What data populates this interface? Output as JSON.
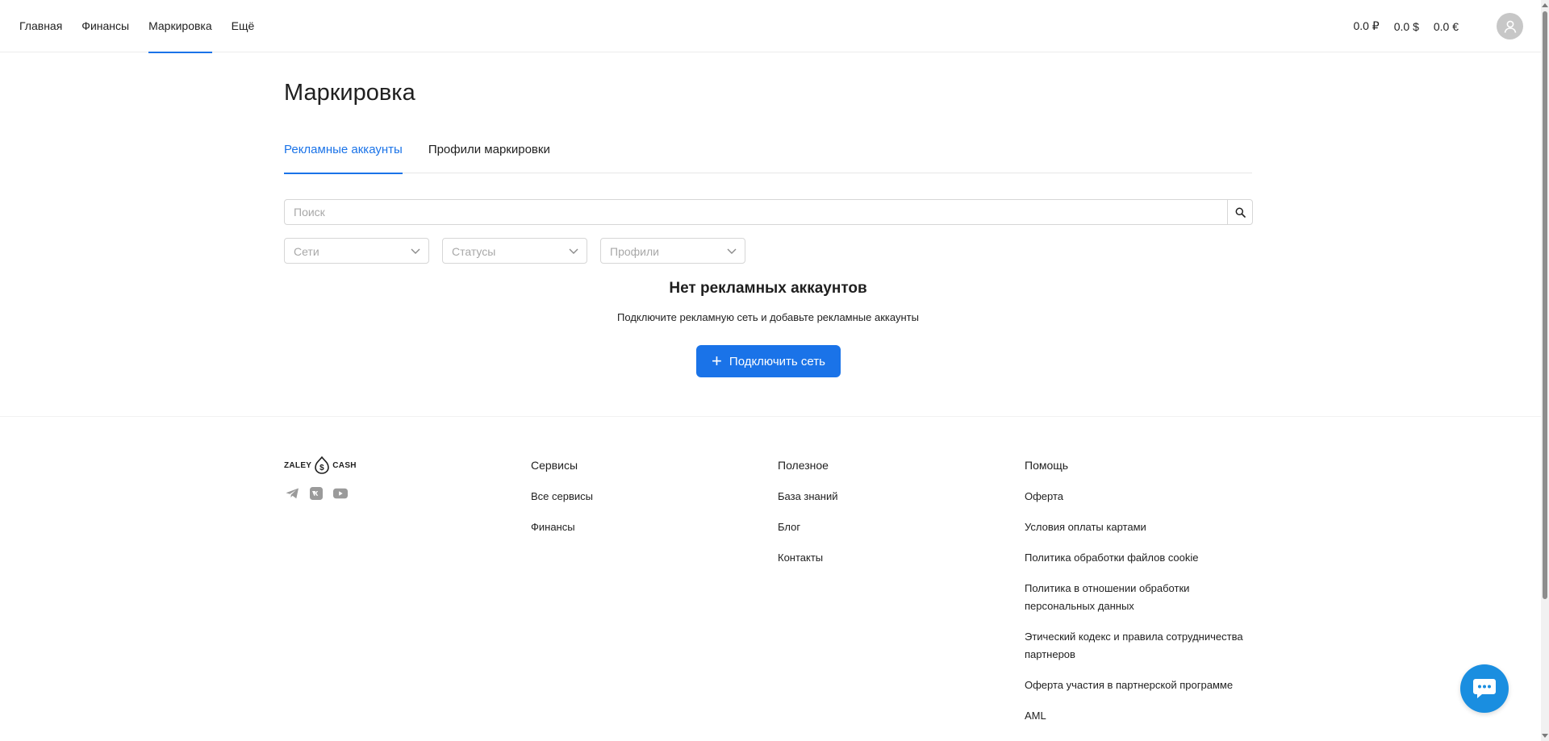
{
  "nav": {
    "items": [
      {
        "label": "Главная"
      },
      {
        "label": "Финансы"
      },
      {
        "label": "Маркировка",
        "active": true
      },
      {
        "label": "Ещё"
      }
    ]
  },
  "balances": [
    "0.0 ₽",
    "0.0 $",
    "0.0 €"
  ],
  "page": {
    "title": "Маркировка"
  },
  "tabs": [
    {
      "label": "Рекламные аккаунты",
      "active": true
    },
    {
      "label": "Профили маркировки"
    }
  ],
  "search": {
    "placeholder": "Поиск",
    "value": ""
  },
  "filters": [
    {
      "placeholder": "Сети"
    },
    {
      "placeholder": "Статусы"
    },
    {
      "placeholder": "Профили"
    }
  ],
  "empty_state": {
    "title": "Нет рекламных аккаунтов",
    "subtitle": "Подключите рекламную сеть и добавьте рекламные аккаунты",
    "button_label": "Подключить сеть"
  },
  "footer": {
    "logo": {
      "left": "ZALEY",
      "right": "CASH"
    },
    "socials": [
      "telegram-icon",
      "vk-icon",
      "youtube-icon"
    ],
    "columns": [
      {
        "title": "Сервисы",
        "links": [
          "Все сервисы",
          "Финансы"
        ]
      },
      {
        "title": "Полезное",
        "links": [
          "База знаний",
          "Блог",
          "Контакты"
        ]
      },
      {
        "title": "Помощь",
        "links": [
          "Оферта",
          "Условия оплаты картами",
          "Политика обработки файлов cookie",
          "Политика в отношении обработки персональных данных",
          "Этический кодекс и правила сотрудничества партнеров",
          "Оферта участия в партнерской программе",
          "AML"
        ]
      }
    ]
  },
  "colors": {
    "accent": "#1a73e8",
    "chat": "#1a8ee0",
    "border": "#d6d6d6",
    "placeholder": "#a8a8a8"
  }
}
